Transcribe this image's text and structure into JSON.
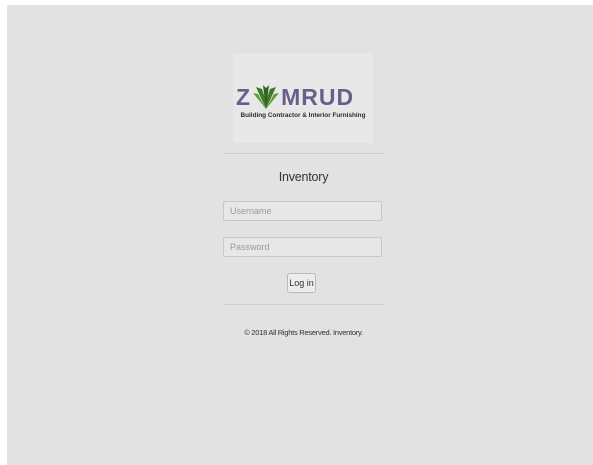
{
  "logo": {
    "brand_left": "Z",
    "brand_right": "MRUD",
    "tagline": "Building Contractor & Interior Furnishing",
    "brand_color": "#6a5d8c",
    "leaf_color": "#3f7a2a",
    "icon": "grass-leaf-logo-mark"
  },
  "form": {
    "title": "Inventory",
    "username_placeholder": "Username",
    "password_placeholder": "Password",
    "login_label": "Log in"
  },
  "footer": {
    "text": "© 2018 All Rights Reserved. Inventory."
  },
  "colors": {
    "background": "#e2e2e2",
    "divider": "#cdcdcd"
  }
}
